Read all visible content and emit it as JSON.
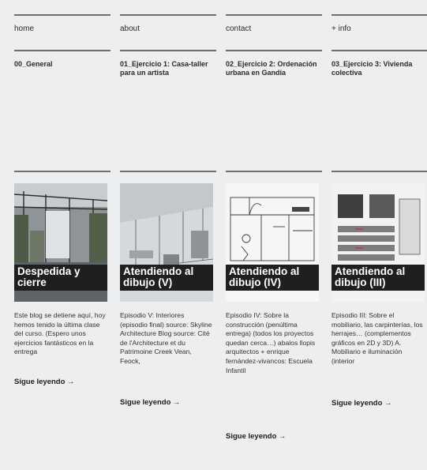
{
  "nav": {
    "items": [
      "home",
      "about",
      "contact",
      "+ info"
    ]
  },
  "sections": [
    "00_General",
    "01_Ejercicio 1: Casa-taller para un artista",
    "02_Ejercicio 2: Ordenación urbana en Gandía",
    "03_Ejercicio 3: Vivienda colectiva"
  ],
  "posts": [
    {
      "title": "Despedida y cierre",
      "excerpt": "Este blog se detiene aquí, hoy hemos tenido la última clase del curso. (Espero unos ejercicios fantásticos en la entrega",
      "more": "Sigue leyendo →"
    },
    {
      "title": "Atendiendo al dibujo (V)",
      "excerpt": "Episodio V: Interiores (episodio final) source: Skyline Architecture Blog   source: Cité de l'Architecture et du Patrimoine Creek Vean, Feock,",
      "more": "Sigue leyendo →"
    },
    {
      "title": "Atendiendo al dibujo (IV)",
      "excerpt": "Episodio IV: Sobre la construcción (penúltima entrega) (todos los proyectos quedan cerca…) abalos llopis arquitectos + enrique fernández-vivancos: Escuela Infantil",
      "more": "Sigue leyendo →"
    },
    {
      "title": "Atendiendo al dibujo (III)",
      "excerpt": "Episodio III: Sobre el mobiliario, las carpinterías, los herrajes… (complementos gráficos en 2D y 3D)  A. Mobiliario e iluminación (interior",
      "more": "Sigue leyendo →"
    }
  ]
}
